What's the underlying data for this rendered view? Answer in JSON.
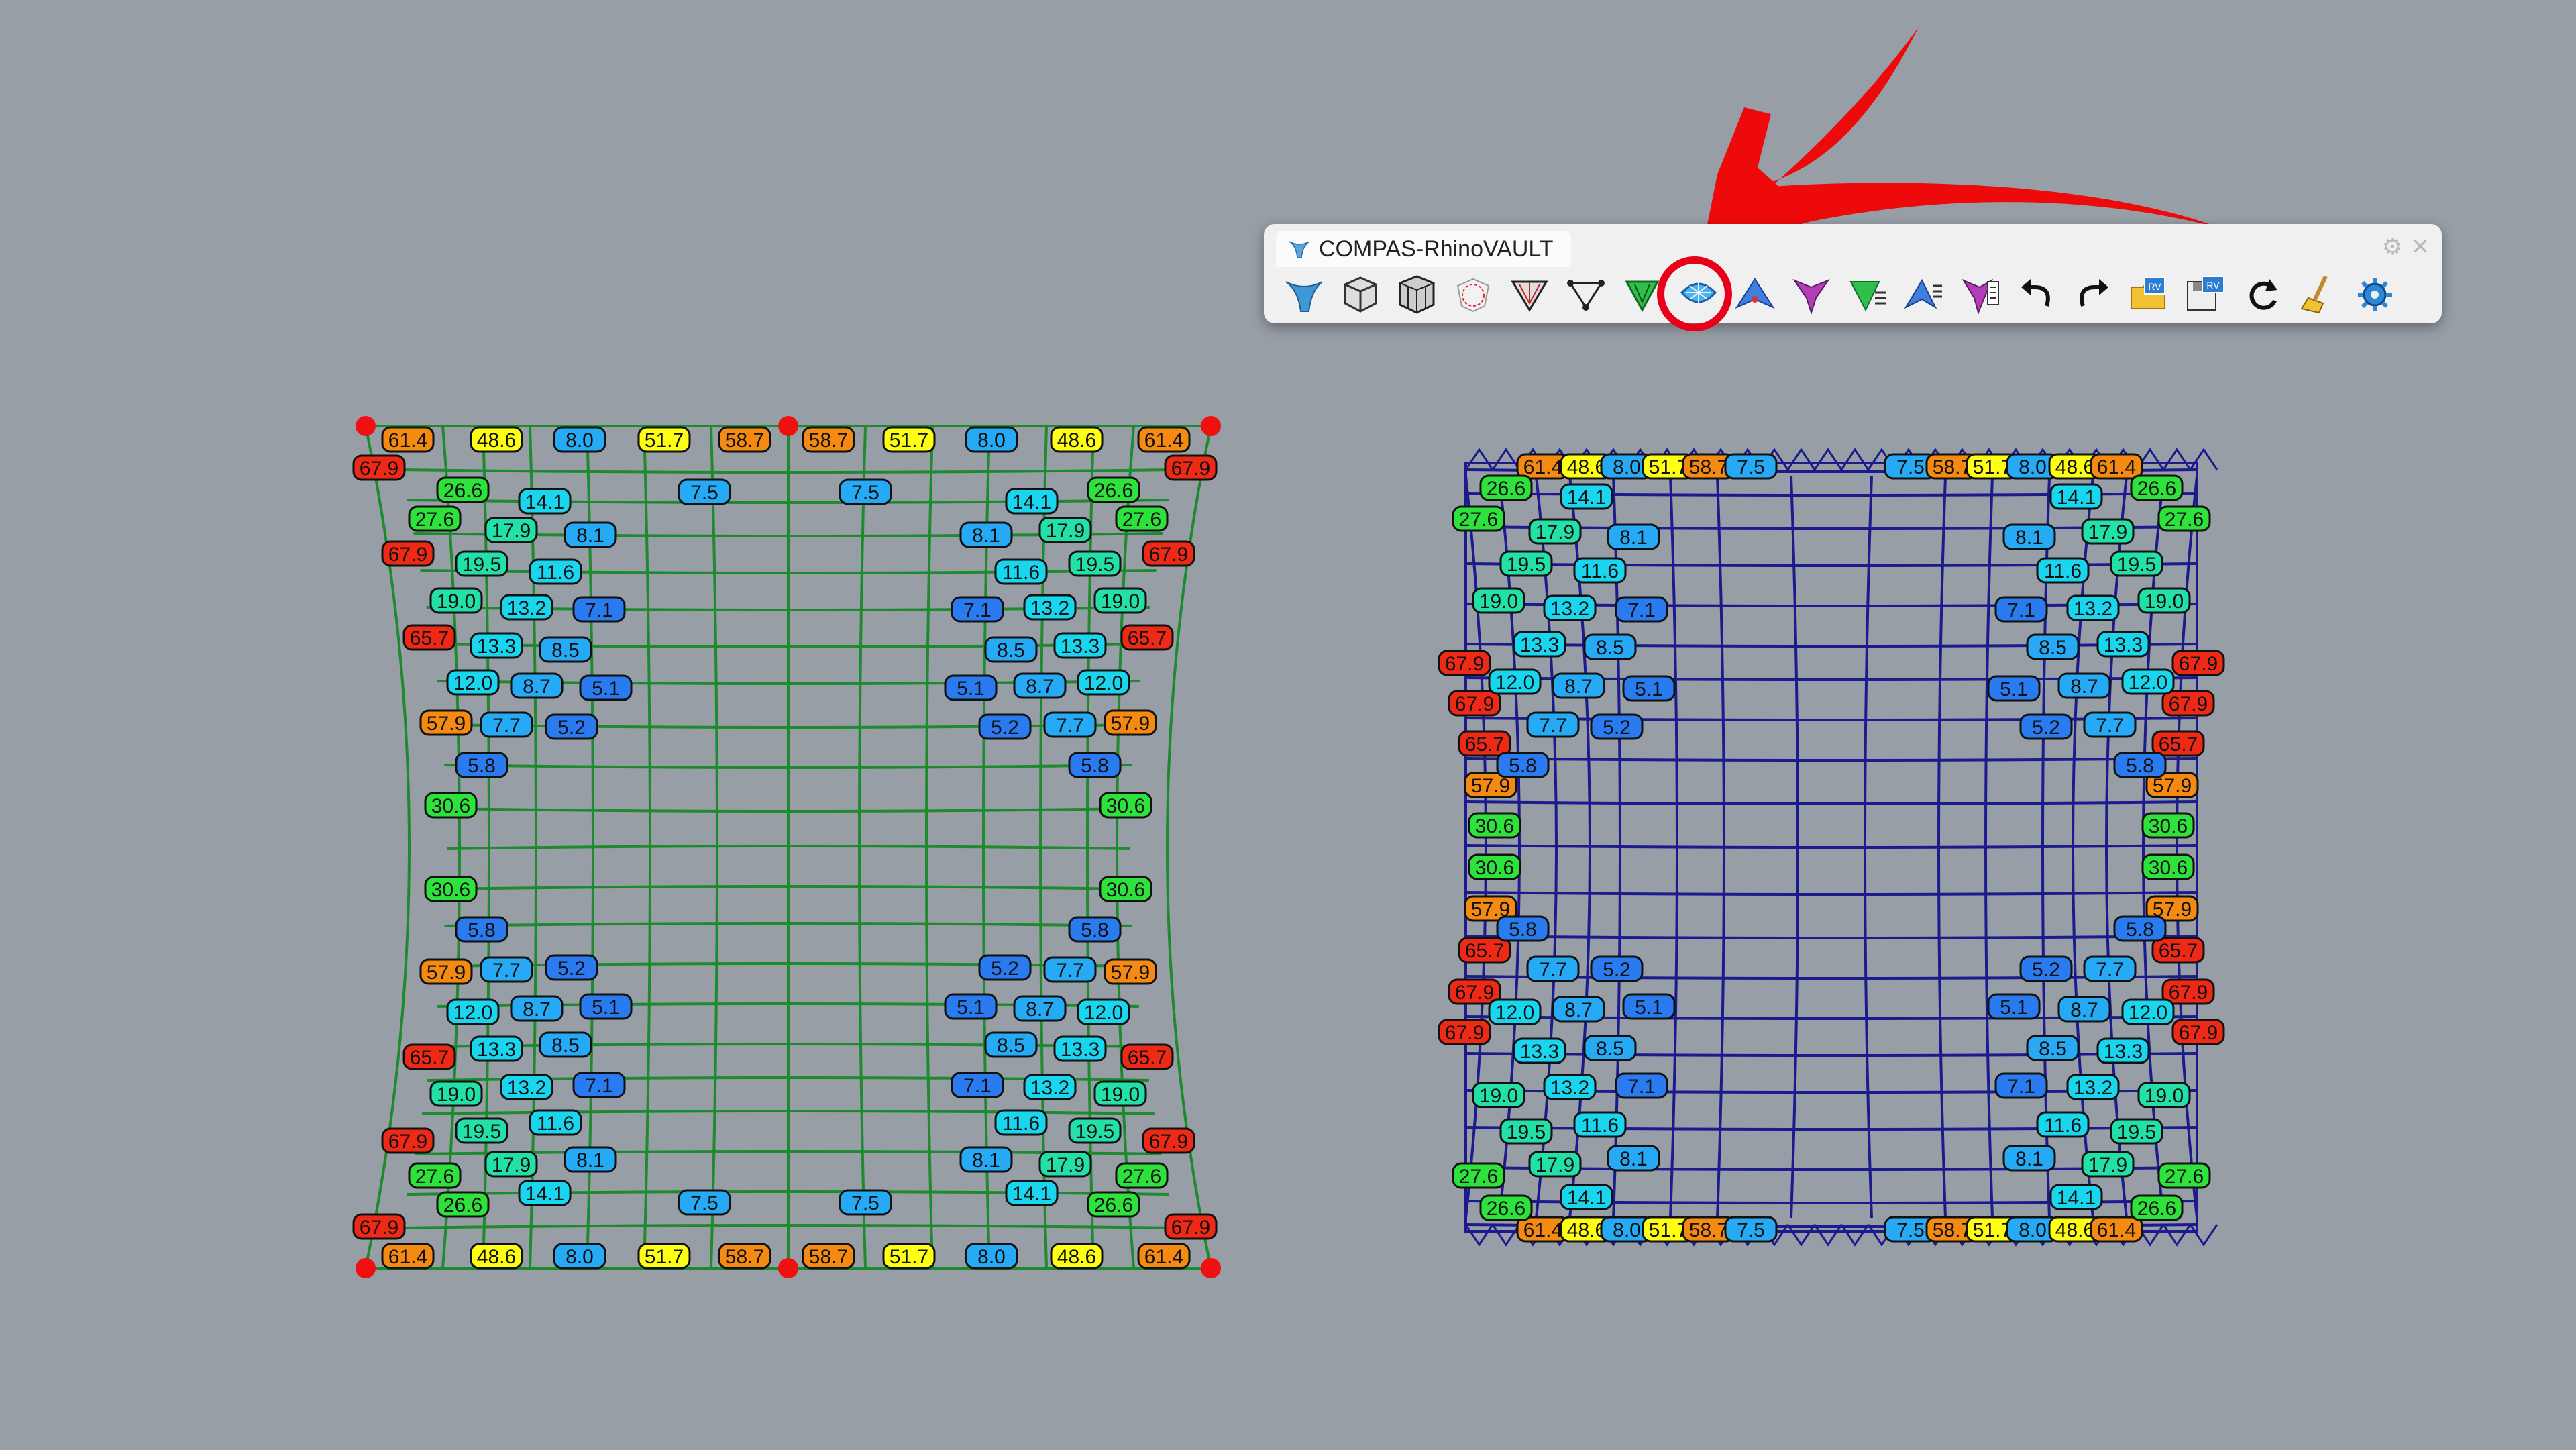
{
  "toolbar": {
    "title": "COMPAS-RhinoVAULT",
    "gear_icon": "gear-icon",
    "close_icon": "close-icon",
    "buttons": [
      {
        "name": "rv-init",
        "icon": "rhinovault-logo-icon"
      },
      {
        "name": "pattern-from-surface",
        "icon": "pattern-cube-icon"
      },
      {
        "name": "pattern-from-mesh",
        "icon": "pattern-box-icon"
      },
      {
        "name": "boundaries",
        "icon": "boundary-sphere-icon"
      },
      {
        "name": "form-diagram",
        "icon": "form-diagram-icon"
      },
      {
        "name": "supports",
        "icon": "supports-icon"
      },
      {
        "name": "force-diagram",
        "icon": "force-diagram-icon"
      },
      {
        "name": "thrust-network",
        "icon": "thrust-dome-icon",
        "highlighted": true
      },
      {
        "name": "horizontal-equilibrium",
        "icon": "horizontal-equilibrium-icon"
      },
      {
        "name": "vertical-equilibrium",
        "icon": "vertical-equilibrium-icon"
      },
      {
        "name": "modify-form",
        "icon": "modify-form-icon"
      },
      {
        "name": "modify-force",
        "icon": "modify-force-icon"
      },
      {
        "name": "modify-thrust",
        "icon": "modify-thrust-icon"
      },
      {
        "name": "undo",
        "icon": "undo-icon"
      },
      {
        "name": "redo",
        "icon": "redo-icon"
      },
      {
        "name": "open",
        "icon": "open-folder-icon"
      },
      {
        "name": "save",
        "icon": "save-icon"
      },
      {
        "name": "reload",
        "icon": "reload-icon"
      },
      {
        "name": "clear",
        "icon": "broom-icon"
      },
      {
        "name": "settings",
        "icon": "settings-gear-icon"
      }
    ]
  },
  "annotation": {
    "arrow_color": "#ee0a0a",
    "highlight_color": "#e8001a"
  },
  "colors": {
    "background": "#979ea6",
    "form_mesh": "#1d8a2e",
    "thrust_mesh": "#1b1b8e",
    "support_point": "#f01010"
  },
  "form_diagram_labels": {
    "top_row": [
      "61.4",
      "48.6",
      "8.0",
      "51.7",
      "58.7",
      "58.7",
      "51.7",
      "8.0",
      "48.6",
      "61.4"
    ],
    "corner_labels": [
      "67.9",
      "67.9",
      "67.9",
      "67.9"
    ],
    "upper_left": [
      "26.6",
      "14.1",
      "27.6",
      "17.9",
      "8.1",
      "67.9",
      "19.5",
      "11.6",
      "19.0",
      "13.2",
      "7.1",
      "65.7",
      "13.3",
      "8.5",
      "12.0",
      "8.7",
      "5.1",
      "57.9",
      "7.7",
      "5.2",
      "5.8",
      "30.6"
    ],
    "upper_right": [
      "26.6",
      "14.1",
      "27.6",
      "17.9",
      "8.1",
      "67.9",
      "19.5",
      "11.6",
      "19.0",
      "13.2",
      "7.1",
      "65.7",
      "13.3",
      "8.5",
      "12.0",
      "8.7",
      "5.1",
      "57.9",
      "7.7",
      "5.2",
      "5.8",
      "30.6"
    ],
    "inner_top": [
      "7.5",
      "7.5"
    ],
    "bottom_row": [
      "61.4",
      "48.6",
      "8.0",
      "51.7",
      "58.7",
      "58.7",
      "51.7",
      "8.0",
      "48.6",
      "61.4"
    ],
    "inner_bottom": [
      "7.5",
      "7.5"
    ]
  },
  "thrust_diagram_labels": {
    "top_row": [
      "61.4",
      "48.6",
      "8.0",
      "51.7",
      "58.7",
      "7.5",
      "7.5",
      "58.7",
      "51.7",
      "8.0",
      "48.6",
      "61.4"
    ],
    "left_outer": [
      "26.6",
      "27.6",
      "67.9",
      "67.9",
      "65.7",
      "57.9",
      "30.6",
      "30.6",
      "57.9",
      "65.7",
      "67.9",
      "67.9",
      "27.6",
      "26.6"
    ],
    "left_inner": [
      "14.1",
      "17.9",
      "19.5",
      "19.0",
      "13.3",
      "12.0",
      "7.7",
      "5.8",
      "5.8",
      "7.7",
      "12.0",
      "13.3",
      "19.0",
      "19.5",
      "17.9",
      "14.1"
    ],
    "left_core": [
      "8.1",
      "11.6",
      "13.2",
      "7.1",
      "8.5",
      "8.7",
      "5.1",
      "5.2",
      "5.2",
      "8.7",
      "5.1",
      "8.5",
      "13.2",
      "7.1",
      "11.6",
      "8.1"
    ],
    "bottom_row": [
      "61.4",
      "48.6",
      "8.0",
      "51.7",
      "58.7",
      "7.5",
      "7.5",
      "58.7",
      "51.7",
      "8.0",
      "48.6",
      "61.4"
    ]
  },
  "badge_palette": {
    "red": "#ee2a16",
    "orange": "#f58a13",
    "yellow": "#ffff14",
    "green": "#2ee23c",
    "mint": "#22e0a8",
    "cyan": "#1ad5ee",
    "sky": "#26aaf5",
    "blue": "#2a7bf0"
  }
}
